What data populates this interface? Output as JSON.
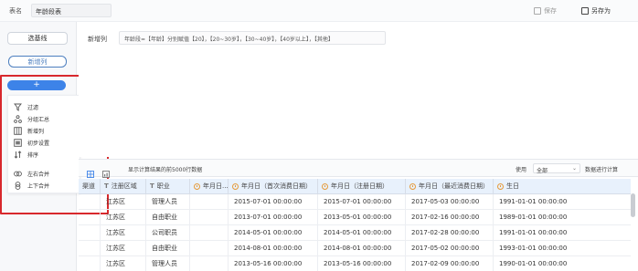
{
  "topbar": {
    "name_label": "表名",
    "table_name": "年龄段表",
    "save_label": "保存",
    "save_as_label": "另存为"
  },
  "sidebar": {
    "select_field_label": "选基线",
    "new_column_label": "新增列",
    "add_button_label": "+"
  },
  "menu": {
    "items": [
      {
        "label": "过滤",
        "icon": "filter-icon"
      },
      {
        "label": "分组汇总",
        "icon": "group-summary-icon"
      },
      {
        "label": "新增列",
        "icon": "new-column-icon"
      },
      {
        "label": "初步设置",
        "icon": "settings-table-icon"
      },
      {
        "label": "排序",
        "icon": "sort-icon"
      },
      {
        "label": "左右合并",
        "icon": "merge-horizontal-icon"
      },
      {
        "label": "上下合并",
        "icon": "merge-vertical-icon"
      }
    ]
  },
  "formula": {
    "label": "新增列",
    "text": "年龄段=【年龄】分别赋值【20】，【20~30岁】，【30~40岁】，【40岁以上】，【其他】"
  },
  "result_toolbar": {
    "info_text": "显示计算结果的前5000行数据",
    "use_label": "使用",
    "select_value": "全部",
    "compute_label": "数据进行计算"
  },
  "table": {
    "columns": [
      {
        "label": "渠道",
        "type": "none"
      },
      {
        "label": "注册区域",
        "type": "text"
      },
      {
        "label": "职业",
        "type": "text"
      },
      {
        "label": "年月日...",
        "type": "date"
      },
      {
        "label": "年月日（首次消费日期）",
        "type": "date"
      },
      {
        "label": "年月日（注册日期）",
        "type": "date"
      },
      {
        "label": "年月日（最近消费日期）",
        "type": "date"
      },
      {
        "label": "生日",
        "type": "date"
      }
    ],
    "rows": [
      [
        "",
        "江苏区",
        "管理人员",
        "",
        "2015-07-01 00:00:00",
        "2015-07-01 00:00:00",
        "2017-05-03 00:00:00",
        "1991-01-01 00:00:00"
      ],
      [
        "",
        "江苏区",
        "自由职业",
        "",
        "2013-07-01 00:00:00",
        "2013-05-01 00:00:00",
        "2017-02-16 00:00:00",
        "1989-01-01 00:00:00"
      ],
      [
        "",
        "江苏区",
        "公司职员",
        "",
        "2014-05-01 00:00:00",
        "2014-05-01 00:00:00",
        "2017-02-28 00:00:00",
        "1991-01-01 00:00:00"
      ],
      [
        "",
        "江苏区",
        "自由职业",
        "",
        "2014-08-01 00:00:00",
        "2014-08-01 00:00:00",
        "2017-05-02 00:00:00",
        "1993-01-01 00:00:00"
      ],
      [
        "",
        "江苏区",
        "管理人员",
        "",
        "2013-05-16 00:00:00",
        "2013-05-16 00:00:00",
        "2017-02-09 00:00:00",
        "1990-01-01 00:00:00"
      ]
    ]
  },
  "colors": {
    "accent": "#3d83e8",
    "highlight_border": "#d8282c",
    "header_bg": "#e8f1fc"
  }
}
